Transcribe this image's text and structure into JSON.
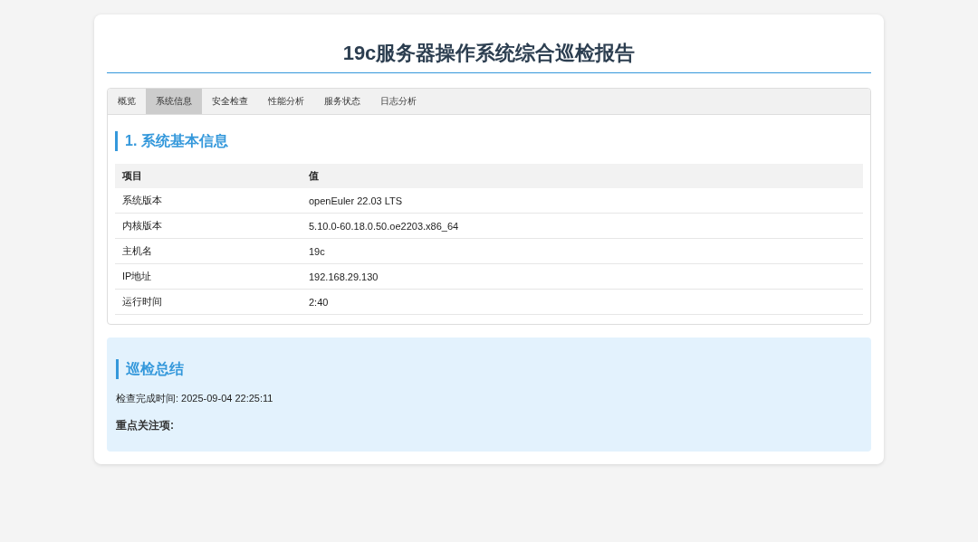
{
  "title": "19c服务器操作系统综合巡检报告",
  "tabs": [
    {
      "label": "概览",
      "selected": false
    },
    {
      "label": "系统信息",
      "selected": true
    },
    {
      "label": "安全检查",
      "selected": false
    },
    {
      "label": "性能分析",
      "selected": false
    },
    {
      "label": "服务状态",
      "selected": false
    },
    {
      "label": "日志分析",
      "selected": false
    }
  ],
  "section": {
    "heading": "1. 系统基本信息",
    "columns": [
      "项目",
      "值"
    ],
    "rows": [
      [
        "系统版本",
        "openEuler 22.03 LTS"
      ],
      [
        "内核版本",
        "5.10.0-60.18.0.50.oe2203.x86_64"
      ],
      [
        "主机名",
        "19c"
      ],
      [
        "IP地址",
        "192.168.29.130"
      ],
      [
        "运行时间",
        "2:40"
      ]
    ]
  },
  "summary": {
    "heading": "巡检总结",
    "completed": "检查完成时间: 2025-09-04 22:25:11",
    "focus_label": "重点关注项:"
  }
}
